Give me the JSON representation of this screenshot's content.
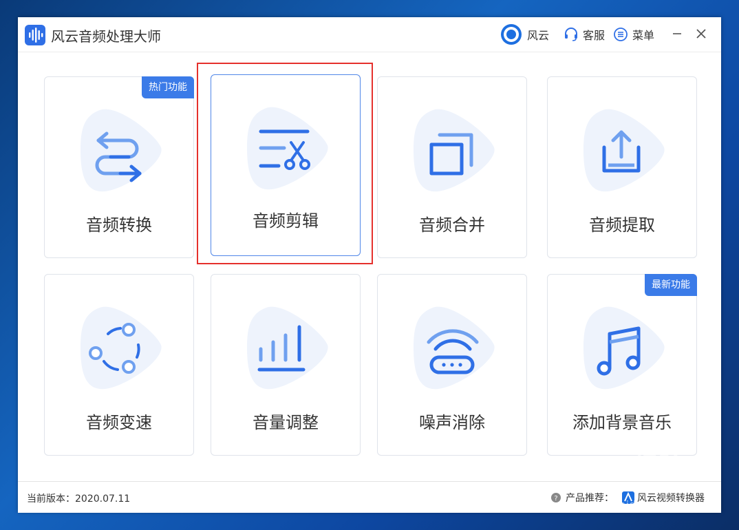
{
  "window": {
    "title": "风云音频处理大师"
  },
  "toolbar": {
    "user_label": "风云",
    "service_label": "客服",
    "menu_label": "菜单"
  },
  "cards": [
    {
      "label": "音频转换",
      "badge": "热门功能"
    },
    {
      "label": "音频剪辑"
    },
    {
      "label": "音频合并"
    },
    {
      "label": "音频提取"
    },
    {
      "label": "音频变速"
    },
    {
      "label": "音量调整"
    },
    {
      "label": "噪声消除"
    },
    {
      "label": "添加背景音乐",
      "badge": "最新功能"
    }
  ],
  "footer": {
    "version_label": "当前版本：2020.07.11",
    "recommend_label": "产品推荐：",
    "product_name": "风云视频转换器"
  },
  "watermark": {
    "text": "Baidu经验",
    "url": "jingyan.baidu.com"
  },
  "colors": {
    "accent": "#3b7be8",
    "blob": "#eef3fc",
    "highlight": "#e5302c"
  }
}
